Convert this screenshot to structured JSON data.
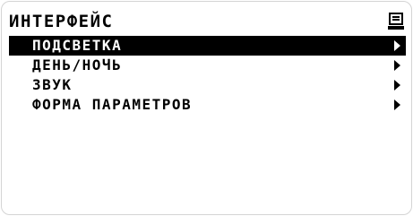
{
  "header": {
    "title": "ИНТЕРФЕЙС",
    "icon": "monitor-icon"
  },
  "menu": {
    "selected_index": 0,
    "items": [
      {
        "label": "ПОДСВЕТКА",
        "icon": "chevron-right-icon"
      },
      {
        "label": "ДЕНЬ/НОЧЬ",
        "icon": "chevron-right-icon"
      },
      {
        "label": "ЗВУК",
        "icon": "chevron-right-icon"
      },
      {
        "label": "ФОРМА ПАРАМЕТРОВ",
        "icon": "chevron-right-icon"
      }
    ]
  },
  "colors": {
    "background": "#ffffff",
    "foreground": "#000000",
    "selection_background": "#000000",
    "selection_foreground": "#ffffff"
  }
}
